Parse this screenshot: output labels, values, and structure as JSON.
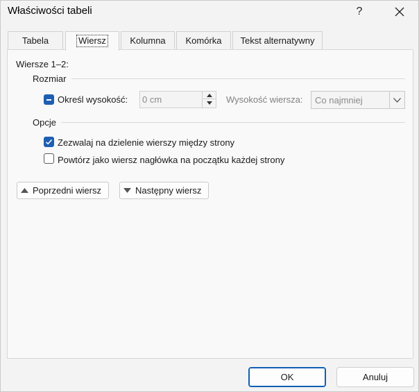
{
  "window": {
    "title": "Właściwości tabeli",
    "help_glyph": "?",
    "close_glyph": "✕"
  },
  "tabs": [
    {
      "label": "Tabela",
      "active": false
    },
    {
      "label": "Wiersz",
      "active": true
    },
    {
      "label": "Kolumna",
      "active": false
    },
    {
      "label": "Komórka",
      "active": false
    },
    {
      "label": "Tekst alternatywny",
      "active": false
    }
  ],
  "rows_panel": {
    "rows_label": "Wiersze 1–2:",
    "size_group": {
      "title": "Rozmiar",
      "specify_height_label": "Określ wysokość:",
      "specify_height_state": "indeterminate",
      "height_value": "0 cm",
      "row_height_label": "Wysokość wiersza:",
      "row_height_mode": "Co najmniej"
    },
    "options_group": {
      "title": "Opcje",
      "allow_break": {
        "label": "Zezwalaj na dzielenie wierszy między strony",
        "checked": true
      },
      "repeat_header": {
        "label": "Powtórz jako wiersz nagłówka na początku każdej strony",
        "checked": false
      }
    },
    "previous_row_label": "Poprzedni wiersz",
    "next_row_label": "Następny wiersz"
  },
  "footer": {
    "ok_label": "OK",
    "cancel_label": "Anuluj"
  },
  "colors": {
    "accent": "#1f5fb3",
    "disabled_text": "#808080",
    "background": "#f3f3f3"
  },
  "icons": {
    "prev_row": "triangle-up-icon",
    "next_row": "triangle-down-icon",
    "combo": "chevron-down-icon",
    "spin_up": "spin-up-icon",
    "spin_down": "spin-down-icon",
    "checkmark": "checkmark-icon"
  }
}
